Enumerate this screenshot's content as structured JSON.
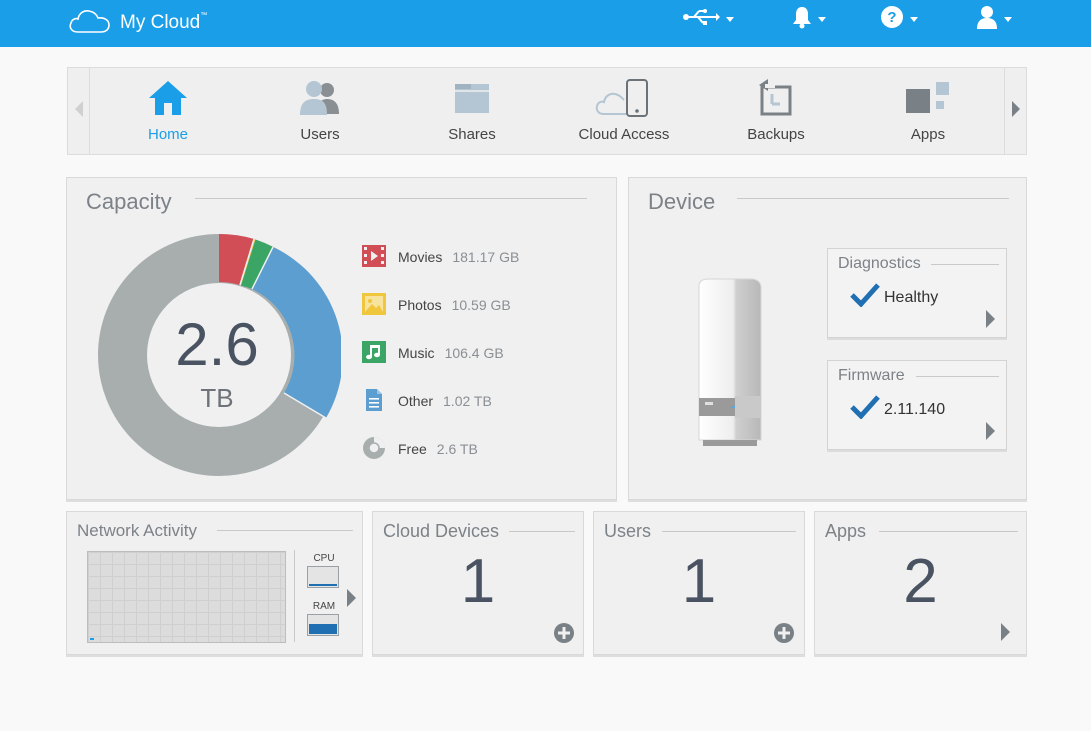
{
  "app": {
    "title": "My Cloud",
    "trademark": "™"
  },
  "topbar": {
    "icons": [
      "usb-icon",
      "bell-icon",
      "help-icon",
      "user-icon"
    ]
  },
  "nav": {
    "items": [
      {
        "label": "Home",
        "icon": "home-icon",
        "active": true
      },
      {
        "label": "Users",
        "icon": "users-icon",
        "active": false
      },
      {
        "label": "Shares",
        "icon": "folder-icon",
        "active": false
      },
      {
        "label": "Cloud Access",
        "icon": "cloud-device-icon",
        "active": false
      },
      {
        "label": "Backups",
        "icon": "backup-icon",
        "active": false
      },
      {
        "label": "Apps",
        "icon": "apps-icon",
        "active": false
      }
    ]
  },
  "capacity": {
    "title": "Capacity",
    "total_value": "2.6",
    "total_unit": "TB",
    "legend": [
      {
        "name": "Movies",
        "value": "181.17 GB",
        "icon": "movie-icon",
        "color": "#d14e57"
      },
      {
        "name": "Photos",
        "value": "10.59 GB",
        "icon": "photo-icon",
        "color": "#f0c63c"
      },
      {
        "name": "Music",
        "value": "106.4 GB",
        "icon": "music-icon",
        "color": "#3aa564"
      },
      {
        "name": "Other",
        "value": "1.02 TB",
        "icon": "document-icon",
        "color": "#5b9ecf"
      },
      {
        "name": "Free",
        "value": "2.6 TB",
        "icon": "pie-icon",
        "color": "#a8aeae"
      }
    ]
  },
  "device": {
    "title": "Device",
    "diagnostics": {
      "title": "Diagnostics",
      "status": "Healthy"
    },
    "firmware": {
      "title": "Firmware",
      "version": "2.11.140"
    }
  },
  "network": {
    "title": "Network Activity",
    "cpu_label": "CPU",
    "ram_label": "RAM"
  },
  "cloud_devices": {
    "title": "Cloud Devices",
    "count": "1"
  },
  "users_card": {
    "title": "Users",
    "count": "1"
  },
  "apps_card": {
    "title": "Apps",
    "count": "2"
  },
  "colors": {
    "brand": "#1a9ee7",
    "check": "#1f6fb2"
  }
}
